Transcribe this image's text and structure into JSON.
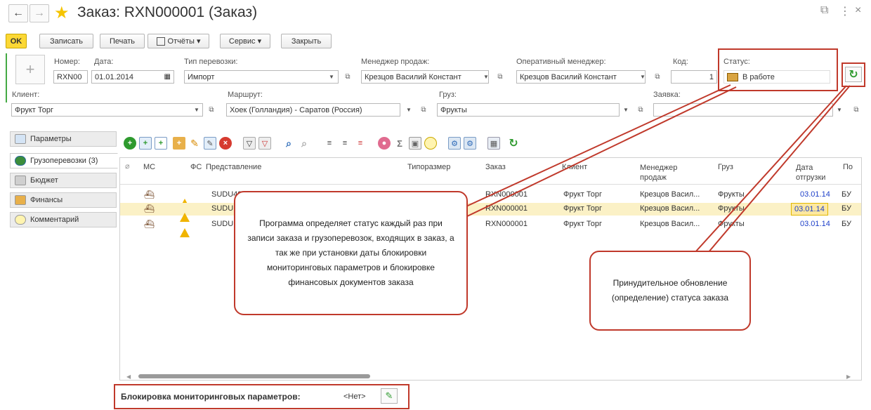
{
  "window": {
    "title": "Заказ: RXN000001 (Заказ)",
    "link_icon": "link-icon",
    "more_icon": "more-icon",
    "close_label": "×"
  },
  "toolbar": {
    "ok": "OK",
    "save": "Записать",
    "print": "Печать",
    "reports": "Отчёты ▾",
    "service": "Сервис ▾",
    "close": "Закрыть"
  },
  "header": {
    "number_label": "Номер:",
    "number_value": "RXN00",
    "date_label": "Дата:",
    "date_value": "01.01.2014",
    "transport_label": "Тип перевозки:",
    "transport_value": "Импорт",
    "sales_manager_label": "Менеджер продаж:",
    "sales_manager_value": "Крезцов Василий Констант",
    "op_manager_label": "Оперативный менеджер:",
    "op_manager_value": "Крезцов Василий Констант",
    "code_label": "Код:",
    "code_value": "1",
    "status_label": "Статус:",
    "status_value": "В работе",
    "client_label": "Клиент:",
    "client_value": "Фрукт Торг",
    "route_label": "Маршрут:",
    "route_value": "Хоек (Голландия) - Саратов (Россия)",
    "cargo_label": "Груз:",
    "cargo_value": "Фрукты",
    "request_label": "Заявка:",
    "request_value": ""
  },
  "tabs": [
    {
      "label": "Параметры",
      "icon": "params-icon"
    },
    {
      "label": "Грузоперевозки (3)",
      "icon": "globe-icon"
    },
    {
      "label": "Бюджет",
      "icon": "calculator-icon"
    },
    {
      "label": "Финансы",
      "icon": "finance-icon"
    },
    {
      "label": "Комментарий",
      "icon": "comment-icon"
    }
  ],
  "table": {
    "headers": {
      "attach": "",
      "ms": "МС",
      "fs": "ФС",
      "presentation": "Представление",
      "size": "Типоразмер",
      "order": "Заказ",
      "client": "Клиент",
      "manager": "Менеджер продаж",
      "cargo": "Груз",
      "ship_date": "Дата отгрузки",
      "po": "По"
    },
    "rows": [
      {
        "presentation": "SUDU48",
        "order": "RXN000001",
        "client": "Фрукт Торг",
        "manager": "Крезцов Васил...",
        "cargo": "Фрукты",
        "ship_date": "03.01.14",
        "po": "БУ"
      },
      {
        "presentation": "SUDU",
        "order": "RXN000001",
        "client": "Фрукт Торг",
        "manager": "Крезцов Васил...",
        "cargo": "Фрукты",
        "ship_date": "03.01.14",
        "po": "БУ"
      },
      {
        "presentation": "SUDU",
        "order": "RXN000001",
        "client": "Фрукт Торг",
        "manager": "Крезцов Васил...",
        "cargo": "Фрукты",
        "ship_date": "03.01.14",
        "po": "БУ"
      }
    ]
  },
  "callouts": {
    "left": "Программа определяет статус каждый раз при записи заказа и грузоперевозок, входящих в заказ, а так же при установки даты блокировки мониторинговых параметров и блокировке финансовых документов заказа",
    "right": "Принудительное обновление (определение) статуса заказа"
  },
  "footer": {
    "lock_label": "Блокировка мониторинговых параметров:",
    "lock_value": "<Нет>"
  },
  "colors": {
    "accent_yellow": "#fcd835",
    "selected_row": "#fbf1c6",
    "callout_border": "#c0392b",
    "date_blue": "#1d3fc9"
  }
}
